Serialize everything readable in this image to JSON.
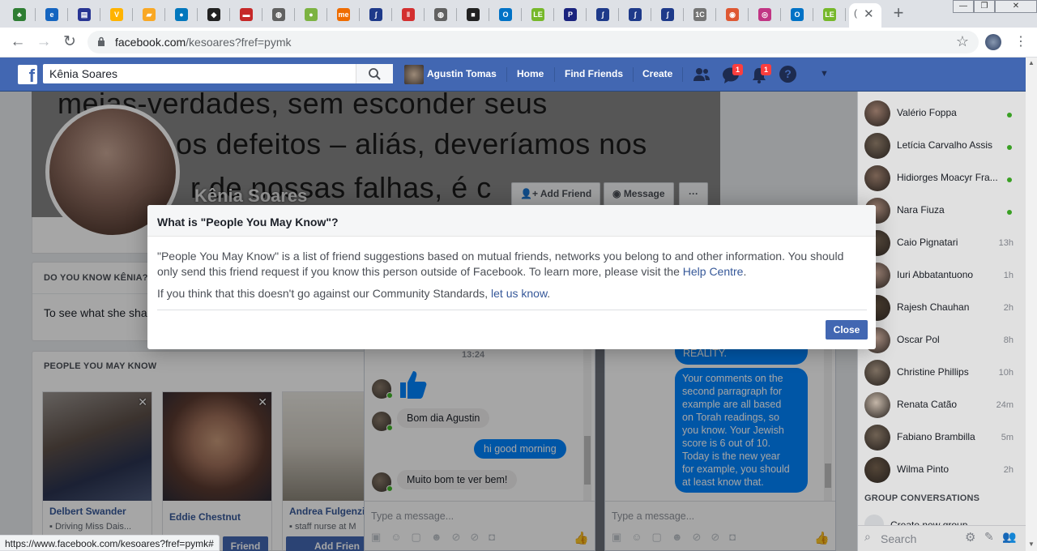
{
  "browser": {
    "url_host": "facebook.com",
    "url_path": "/kesoares?fref=pymk",
    "status_url": "https://www.facebook.com/kesoares?fref=pymk#",
    "tabs": [
      {
        "icon": "tree-icon",
        "color": "#2e7d32",
        "glyph": "♣"
      },
      {
        "icon": "e-icon",
        "color": "#1565c0",
        "glyph": "e"
      },
      {
        "icon": "doc-icon",
        "color": "#283593",
        "glyph": "▤"
      },
      {
        "icon": "v-icon",
        "color": "#ffb300",
        "glyph": "V"
      },
      {
        "icon": "chart-icon",
        "color": "#f9a825",
        "glyph": "▰"
      },
      {
        "icon": "drupal-icon",
        "color": "#0277bd",
        "glyph": "●"
      },
      {
        "icon": "shield-icon",
        "color": "#212121",
        "glyph": "◆"
      },
      {
        "icon": "flag-icon",
        "color": "#c62828",
        "glyph": "▬"
      },
      {
        "icon": "globe-icon",
        "color": "#616161",
        "glyph": "◍"
      },
      {
        "icon": "ball-icon",
        "color": "#7cb342",
        "glyph": "●"
      },
      {
        "icon": "me-icon",
        "color": "#ef6c00",
        "glyph": "me"
      },
      {
        "icon": "swirl-icon",
        "color": "#1e3a8a",
        "glyph": "∫"
      },
      {
        "icon": "bars-icon",
        "color": "#d32f2f",
        "glyph": "‖"
      },
      {
        "icon": "globe-icon",
        "color": "#616161",
        "glyph": "◍"
      },
      {
        "icon": "square-icon",
        "color": "#212121",
        "glyph": "■"
      },
      {
        "icon": "outlook-icon",
        "color": "#0072c6",
        "glyph": "O"
      },
      {
        "icon": "le-icon",
        "color": "#76b82a",
        "glyph": "LE"
      },
      {
        "icon": "p-icon",
        "color": "#1a237e",
        "glyph": "P"
      },
      {
        "icon": "swirl-icon",
        "color": "#1e3a8a",
        "glyph": "∫"
      },
      {
        "icon": "swirl-icon",
        "color": "#1e3a8a",
        "glyph": "∫"
      },
      {
        "icon": "swirl-icon",
        "color": "#1e3a8a",
        "glyph": "∫"
      },
      {
        "icon": "ic-icon",
        "color": "#757575",
        "glyph": "1C"
      },
      {
        "icon": "duckduckgo-icon",
        "color": "#de5833",
        "glyph": "◉"
      },
      {
        "icon": "instagram-icon",
        "color": "#c13584",
        "glyph": "◎"
      },
      {
        "icon": "outlook-icon",
        "color": "#0072c6",
        "glyph": "O"
      },
      {
        "icon": "le-icon",
        "color": "#76b82a",
        "glyph": "LE"
      }
    ],
    "active_tab_label": "(",
    "close_glyph": "✕",
    "new_tab_glyph": "+"
  },
  "fb_header": {
    "search_value": "Kênia Soares",
    "user_name": "Agustin Tomas",
    "nav": [
      "Home",
      "Find Friends",
      "Create"
    ],
    "messages_badge": "1",
    "notifications_badge": "1",
    "help_glyph": "?",
    "brand_color": "#4267b2"
  },
  "profile": {
    "name": "Kênia Soares",
    "cover_lines": [
      "meias-verdades, sem esconder seus",
      "os defeitos – aliás, deveríamos nos",
      "r de nossas falhas, é c"
    ],
    "add_friend": "Add Friend",
    "message": "Message",
    "more": "···"
  },
  "do_you_know": {
    "heading": "DO YOU KNOW KÊNIA?",
    "text": "To see what she sha"
  },
  "pymk": {
    "heading": "PEOPLE YOU MAY KNOW",
    "cards": [
      {
        "name": "Delbert Swander",
        "sub": "Driving Miss Dais...",
        "button": ""
      },
      {
        "name": "Eddie Chestnut",
        "sub": "",
        "button": "Friend"
      },
      {
        "name": "Andrea Fulgenzi",
        "sub": "staff nurse at M",
        "button": "Add Frien"
      }
    ]
  },
  "chat1": {
    "time": "13:24",
    "messages": [
      {
        "from": "them",
        "text": "Bom dia Agustin"
      },
      {
        "from": "me",
        "text": "hi good morning"
      },
      {
        "from": "them",
        "text": "Muito bom te ver bem!"
      }
    ],
    "placeholder": "Type a message..."
  },
  "chat2": {
    "partial_top": "REALITY.",
    "long_message": [
      "Your comments on the",
      "second parragraph for",
      "example are all based",
      "on Torah readings, so",
      "you know. Your Jewish",
      "score is 6 out of 10.",
      "Today is the new year",
      "for example, you should",
      "at least know that."
    ],
    "placeholder": "Type a message..."
  },
  "sidebar": {
    "contacts": [
      {
        "name": "Valério Foppa",
        "time": "",
        "online": true
      },
      {
        "name": "Letícia Carvalho Assis",
        "time": "",
        "online": true
      },
      {
        "name": "Hidiorges Moacyr Fra...",
        "time": "",
        "online": true
      },
      {
        "name": "Nara Fiuza",
        "time": "",
        "online": true
      },
      {
        "name": "Caio Pignatari",
        "time": "13h",
        "online": false
      },
      {
        "name": "Iuri Abbatantuono",
        "time": "1h",
        "online": false
      },
      {
        "name": "Rajesh Chauhan",
        "time": "2h",
        "online": false
      },
      {
        "name": "Oscar Pol",
        "time": "8h",
        "online": false
      },
      {
        "name": "Christine Phillips",
        "time": "10h",
        "online": false
      },
      {
        "name": "Renata Catão",
        "time": "24m",
        "online": false
      },
      {
        "name": "Fabiano Brambilla",
        "time": "5m",
        "online": false
      },
      {
        "name": "Wilma Pinto",
        "time": "2h",
        "online": false
      }
    ],
    "group_heading": "GROUP CONVERSATIONS",
    "create_group": "Create new group",
    "search_placeholder": "Search"
  },
  "modal": {
    "title": "What is \"People You May Know\"?",
    "body": "\"People You May Know\" is a list of friend suggestions based on mutual friends, networks you belong to and other information. You should only send this friend request if you know this person outside of Facebook. To learn more, please visit the ",
    "help_link": "Help Centre",
    "body_end": ".",
    "body2": "If you think that this doesn't go against our Community Standards, ",
    "report_link": "let us know",
    "body2_end": ".",
    "close": "Close"
  }
}
